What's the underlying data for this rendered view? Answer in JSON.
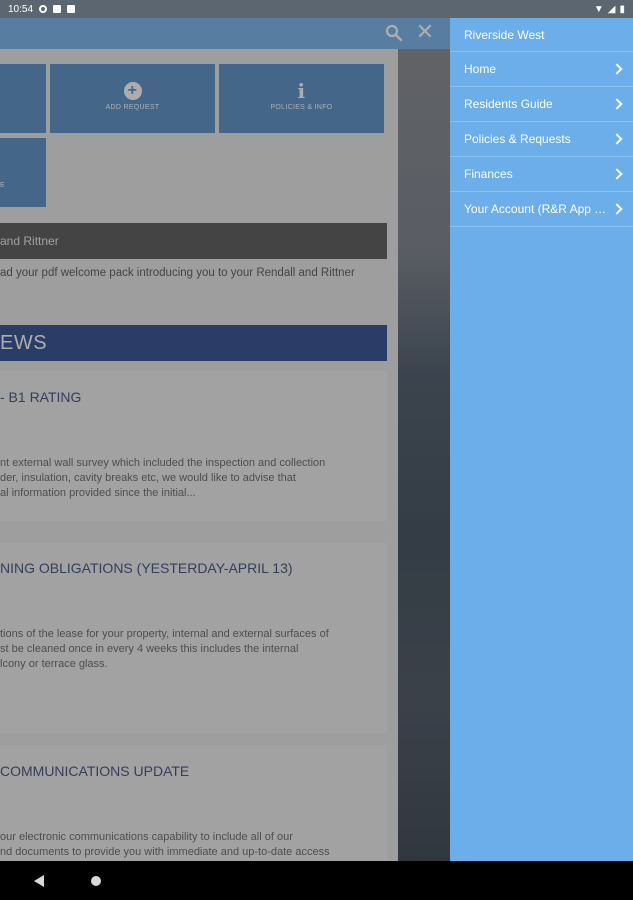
{
  "status_bar": {
    "time": "10:54"
  },
  "app": {
    "tiles": [
      {
        "label": ""
      },
      {
        "label": "ADD REQUEST",
        "icon": "plus-circle-icon"
      },
      {
        "label": "POLICIES & INFO",
        "icon": "info-icon"
      },
      {
        "label": "e"
      }
    ],
    "darkbar_text": "and Rittner",
    "welcome_text": "ad your pdf welcome pack introducing you to your Rendall and Rittner",
    "news_heading": "EWS",
    "news": [
      {
        "title": "- B1 RATING",
        "lines": [
          "nt external wall survey which included the inspection and collection",
          "der, insulation, cavity breaks etc, we would like to advise that",
          "al information provided since the initial..."
        ]
      },
      {
        "title": "NING OBLIGATIONS (YESTERDAY-APRIL 13)",
        "lines": [
          "tions of the lease for your property, internal and external surfaces of",
          "st be cleaned once in every 4 weeks this includes the internal",
          "lcony or terrace glass."
        ]
      },
      {
        "title": "COMMUNICATIONS UPDATE",
        "lines": [
          "our electronic communications capability to include all of our",
          "nd documents to provide you with immediate and up-to-date access"
        ]
      }
    ]
  },
  "drawer": {
    "header": "Riverside West",
    "items": [
      {
        "label": "Home"
      },
      {
        "label": "Residents Guide"
      },
      {
        "label": "Policies & Requests"
      },
      {
        "label": "Finances"
      },
      {
        "label": "Your Account (R&R App T..."
      }
    ]
  }
}
